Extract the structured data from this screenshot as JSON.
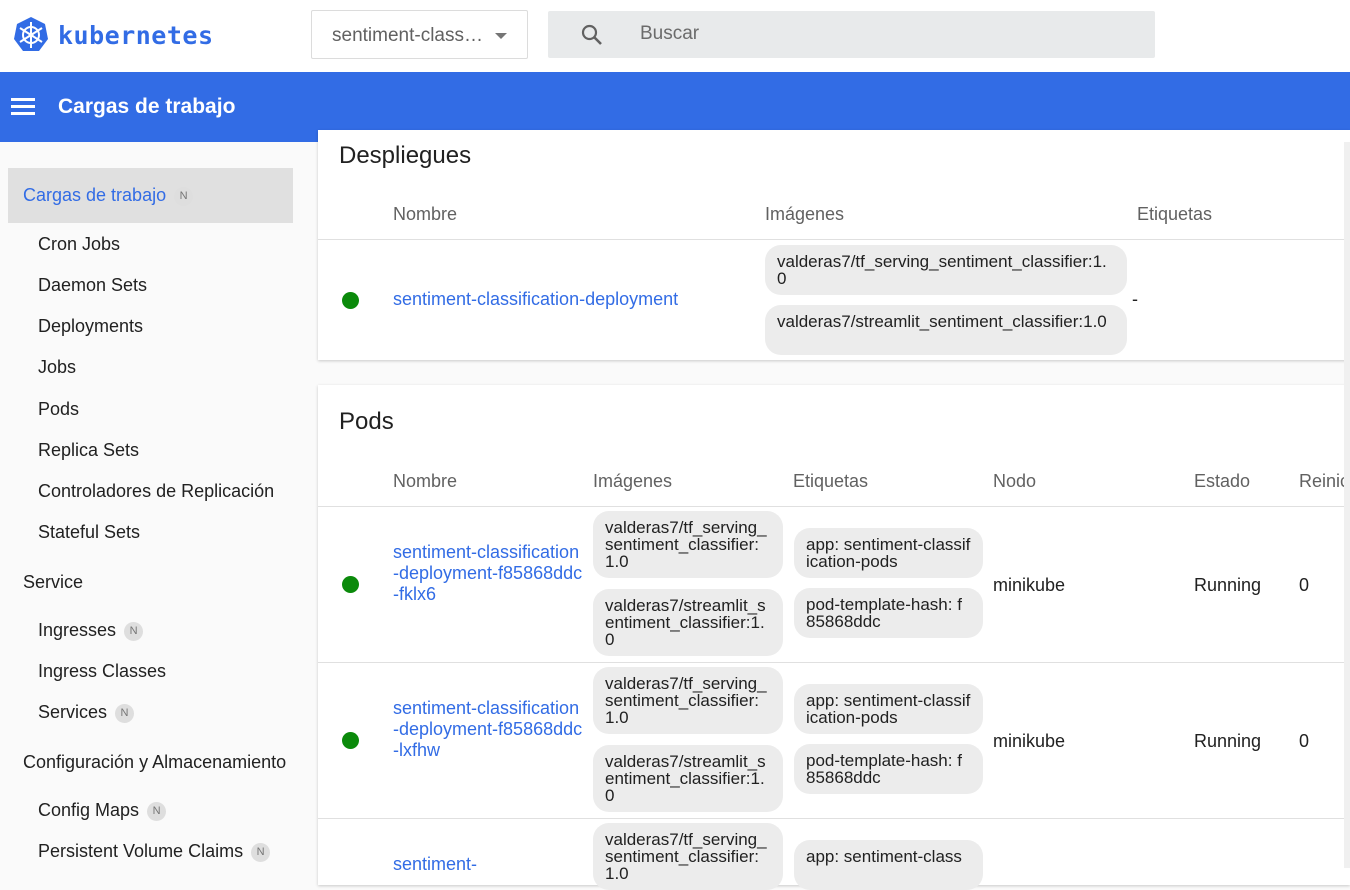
{
  "topbar": {
    "logo_text": "kubernetes",
    "namespace": "sentiment-class…",
    "search_placeholder": "Buscar"
  },
  "header": {
    "title": "Cargas de trabajo"
  },
  "sidebar": {
    "active": {
      "label": "Cargas de trabajo",
      "badge": "N"
    },
    "workloads": [
      "Cron Jobs",
      "Daemon Sets",
      "Deployments",
      "Jobs",
      "Pods",
      "Replica Sets",
      "Controladores de Replicación",
      "Stateful Sets"
    ],
    "service_title": "Service",
    "service_items": [
      {
        "label": "Ingresses",
        "badge": "N"
      },
      {
        "label": "Ingress Classes",
        "badge": ""
      },
      {
        "label": "Services",
        "badge": "N"
      }
    ],
    "config_title": "Configuración y Almacenamiento",
    "config_items": [
      {
        "label": "Config Maps",
        "badge": "N"
      },
      {
        "label": "Persistent Volume Claims",
        "badge": "N"
      }
    ]
  },
  "deployments": {
    "title": "Despliegues",
    "headers": {
      "name": "Nombre",
      "images": "Imágenes",
      "labels": "Etiquetas"
    },
    "rows": [
      {
        "status_color": "#0b8a0b",
        "name": "sentiment-classification-deployment",
        "images": [
          "valderas7/tf_serving_sentiment_classifier:1.0",
          "valderas7/streamlit_sentiment_classifier:1.0"
        ],
        "labels": "-"
      }
    ]
  },
  "pods": {
    "title": "Pods",
    "headers": {
      "name": "Nombre",
      "images": "Imágenes",
      "labels": "Etiquetas",
      "node": "Nodo",
      "status": "Estado",
      "restarts": "Reinici"
    },
    "rows": [
      {
        "status_color": "#0b8a0b",
        "name": "sentiment-classification-deployment-f85868ddc-fklx6",
        "images": [
          "valderas7/tf_serving_sentiment_classifier:1.0",
          "valderas7/streamlit_sentiment_classifier:1.0"
        ],
        "labels": [
          "app: sentiment-classification-pods",
          "pod-template-hash: f85868ddc"
        ],
        "node": "minikube",
        "status": "Running",
        "restarts": "0"
      },
      {
        "status_color": "#0b8a0b",
        "name": "sentiment-classification-deployment-f85868ddc-lxfhw",
        "images": [
          "valderas7/tf_serving_sentiment_classifier:1.0",
          "valderas7/streamlit_sentiment_classifier:1.0"
        ],
        "labels": [
          "app: sentiment-classification-pods",
          "pod-template-hash: f85868ddc"
        ],
        "node": "minikube",
        "status": "Running",
        "restarts": "0"
      },
      {
        "status_color": "#0b8a0b",
        "name": "sentiment-",
        "images": [
          "valderas7/tf_serving_sentiment_classifier:1.0"
        ],
        "labels": [
          "app: sentiment-class"
        ],
        "node": "",
        "status": "",
        "restarts": ""
      }
    ]
  }
}
